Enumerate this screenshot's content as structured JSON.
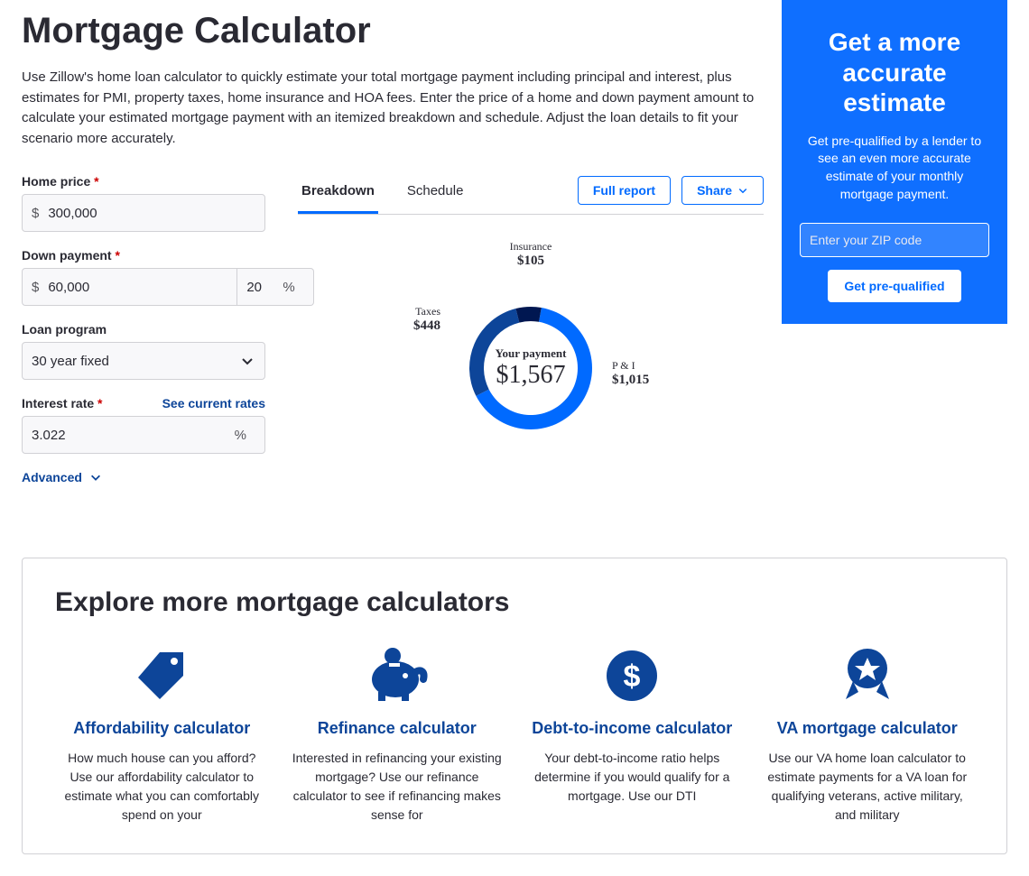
{
  "page": {
    "title": "Mortgage Calculator",
    "intro": "Use Zillow's home loan calculator to quickly estimate your total mortgage payment including principal and interest, plus estimates for PMI, property taxes, home insurance and HOA fees. Enter the price of a home and down payment amount to calculate your estimated mortgage payment with an itemized breakdown and schedule. Adjust the loan details to fit your scenario more accurately."
  },
  "form": {
    "home_price": {
      "label": "Home price",
      "value": "300,000",
      "currency": "$"
    },
    "down_payment": {
      "label": "Down payment",
      "value": "60,000",
      "currency": "$",
      "percent": "20",
      "percent_symbol": "%"
    },
    "loan_program": {
      "label": "Loan program",
      "selected": "30 year fixed"
    },
    "interest_rate": {
      "label": "Interest rate",
      "value": "3.022",
      "symbol": "%",
      "link": "See current rates"
    },
    "advanced": "Advanced"
  },
  "tabs": {
    "breakdown": "Breakdown",
    "schedule": "Schedule",
    "full_report": "Full report",
    "share": "Share"
  },
  "chart_data": {
    "type": "donut",
    "title": "Your payment",
    "total_label": "$1,567",
    "series": [
      {
        "name": "P & I",
        "value": 1015,
        "display": "$1,015",
        "color": "#006aff"
      },
      {
        "name": "Taxes",
        "value": 448,
        "display": "$448",
        "color": "#0d4599"
      },
      {
        "name": "Insurance",
        "value": 105,
        "display": "$105",
        "color": "#001751"
      }
    ]
  },
  "cta": {
    "title": "Get a more accurate estimate",
    "body": "Get pre-qualified by a lender to see an even more accurate estimate of your monthly mortgage payment.",
    "placeholder": "Enter your ZIP code",
    "button": "Get pre-qualified"
  },
  "explore": {
    "title": "Explore more mortgage calculators",
    "cards": [
      {
        "title": "Affordability calculator",
        "body": "How much house can you afford? Use our affordability calculator to estimate what you can comfortably spend on your"
      },
      {
        "title": "Refinance calculator",
        "body": "Interested in refinancing your existing mortgage? Use our refinance calculator to see if refinancing makes sense for"
      },
      {
        "title": "Debt-to-income calculator",
        "body": "Your debt-to-income ratio helps determine if you would qualify for a mortgage. Use our DTI"
      },
      {
        "title": "VA mortgage calculator",
        "body": "Use our VA home loan calculator to estimate payments for a VA loan for qualifying veterans, active military, and military"
      }
    ]
  }
}
